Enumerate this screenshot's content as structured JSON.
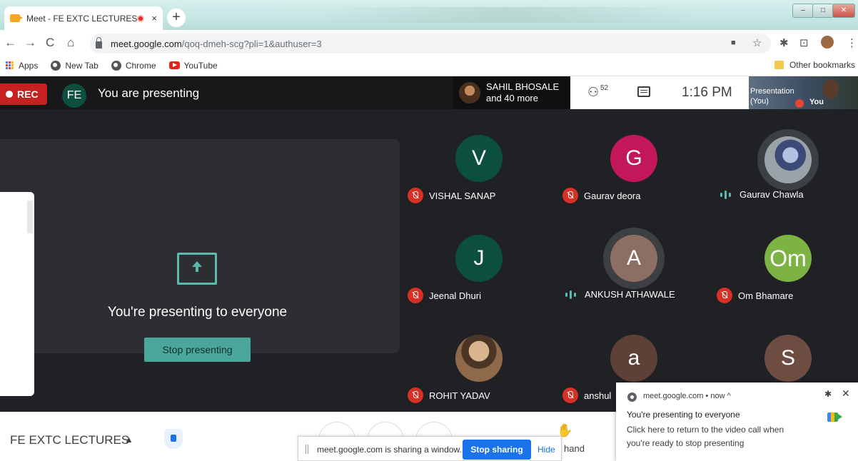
{
  "browser": {
    "tab_title": "Meet - FE EXTC LECTURES",
    "tab_close": "×",
    "new_tab": "+",
    "url_host": "meet.google.com",
    "url_path": "/qoq-dmeh-scg?pli=1&authuser=3",
    "bookmarks": {
      "apps": "Apps",
      "new_tab": "New Tab",
      "chrome": "Chrome",
      "youtube": "YouTube",
      "other": "Other bookmarks"
    }
  },
  "meet": {
    "rec_label": "REC",
    "presenter_initials": "FE",
    "presenting_status": "You are presenting",
    "active_speaker": "SAHIL BHOSALE",
    "active_speaker_more": "and 40 more",
    "people_count": "52",
    "time": "1:16 PM",
    "self_tile_label_1": "Presentation",
    "self_tile_label_2": "(You)",
    "self_label": "You",
    "presenting_message": "You're presenting to everyone",
    "stop_presenting": "Stop presenting",
    "participants": [
      {
        "initial": "V",
        "name": "VISHAL SANAP",
        "color": "#0d4f3f",
        "muted": true
      },
      {
        "initial": "G",
        "name": "Gaurav deora",
        "color": "#c2185b",
        "muted": true
      },
      {
        "initial": "",
        "name": "Gaurav Chawla",
        "color": "#9aa3a8",
        "muted": false,
        "photo": true
      },
      {
        "initial": "J",
        "name": "Jeenal Dhuri",
        "color": "#0d4f3f",
        "muted": true
      },
      {
        "initial": "A",
        "name": "ANKUSH ATHAWALE",
        "color": "#8d6e63",
        "muted": false
      },
      {
        "initial": "Om",
        "name": "Om Bhamare",
        "color": "#7cb342",
        "muted": true
      },
      {
        "initial": "",
        "name": "ROHIT YADAV",
        "color": "#8e6a4a",
        "muted": true,
        "photo": true
      },
      {
        "initial": "a",
        "name": "anshul",
        "color": "#5d4037",
        "muted": true
      },
      {
        "initial": "S",
        "name": "",
        "color": "#6d4c41",
        "muted": true
      }
    ]
  },
  "bottombar": {
    "meeting_name": "FE EXTC LECTURES",
    "raise_hand": "hand"
  },
  "sharebar": {
    "message": "meet.google.com is sharing a window.",
    "stop_sharing": "Stop sharing",
    "hide": "Hide"
  },
  "notification": {
    "source": "meet.google.com  •  now ^",
    "title": "You're presenting to everyone",
    "body": "Click here to return to the video call when you're ready to stop presenting"
  }
}
